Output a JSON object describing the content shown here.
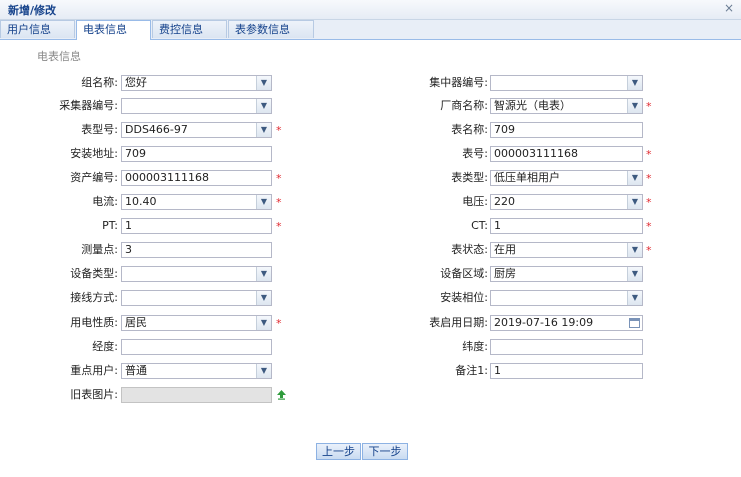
{
  "window": {
    "title": "新增/修改",
    "close_glyph": "×"
  },
  "tabs": [
    {
      "label": "用户信息"
    },
    {
      "label": "电表信息"
    },
    {
      "label": "费控信息"
    },
    {
      "label": "表参数信息"
    }
  ],
  "section_title": "电表信息",
  "left_fields": [
    {
      "label": "组名称:",
      "value": "您好"
    },
    {
      "label": "采集器编号:",
      "value": ""
    },
    {
      "label": "表型号:",
      "value": "DDS466-97"
    },
    {
      "label": "安装地址:",
      "value": "709"
    },
    {
      "label": "资产编号:",
      "value": "000003111168"
    },
    {
      "label": "电流:",
      "value": "10.40"
    },
    {
      "label": "PT:",
      "value": "1"
    },
    {
      "label": "测量点:",
      "value": "3"
    },
    {
      "label": "设备类型:",
      "value": ""
    },
    {
      "label": "接线方式:",
      "value": ""
    },
    {
      "label": "用电性质:",
      "value": "居民"
    },
    {
      "label": "经度:",
      "value": ""
    },
    {
      "label": "重点用户:",
      "value": "普通"
    },
    {
      "label": "旧表图片:",
      "value": ""
    }
  ],
  "right_fields": [
    {
      "label": "集中器编号:",
      "value": ""
    },
    {
      "label": "厂商名称:",
      "value": "智源光（电表）"
    },
    {
      "label": "表名称:",
      "value": "709"
    },
    {
      "label": "表号:",
      "value": "000003111168"
    },
    {
      "label": "表类型:",
      "value": "低压单相用户"
    },
    {
      "label": "电压:",
      "value": "220"
    },
    {
      "label": "CT:",
      "value": "1"
    },
    {
      "label": "表状态:",
      "value": "在用"
    },
    {
      "label": "设备区域:",
      "value": "厨房"
    },
    {
      "label": "安装相位:",
      "value": ""
    },
    {
      "label": "表启用日期:",
      "value": "2019-07-16 19:09"
    },
    {
      "label": "纬度:",
      "value": ""
    },
    {
      "label": "备注1:",
      "value": "1"
    }
  ],
  "required_mark": "*",
  "icons": {
    "dropdown": "chevron-down-icon",
    "calendar": "calendar-icon",
    "upload": "upload-icon"
  },
  "buttons": {
    "prev": "上一步",
    "next": "下一步"
  },
  "colors": {
    "accent": "#15428b",
    "required": "#e0282f",
    "border": "#b5b8c8"
  }
}
